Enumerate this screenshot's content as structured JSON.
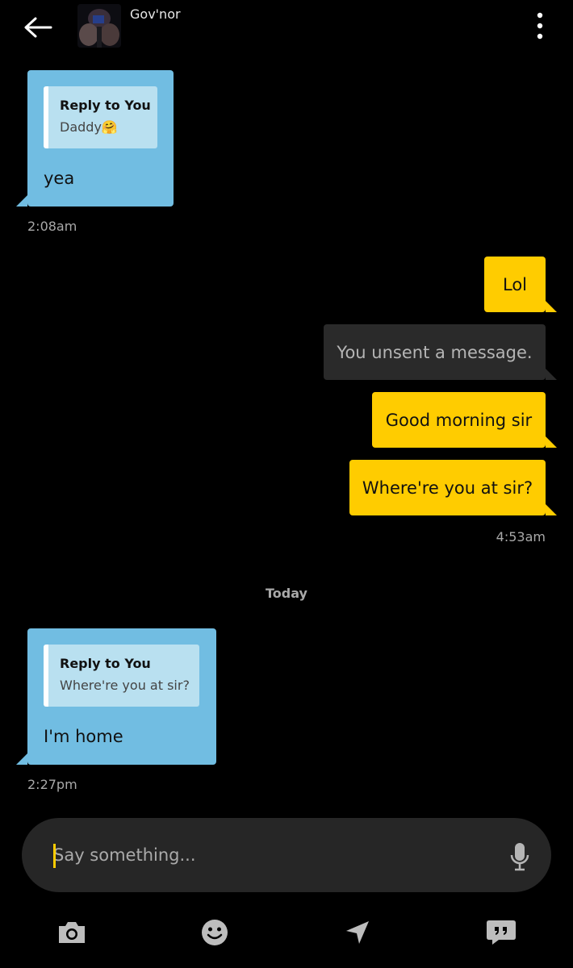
{
  "header": {
    "contact_name": "Gov'nor",
    "back_icon": "arrow-left-icon",
    "more_icon": "more-vertical-icon"
  },
  "messages": [
    {
      "direction": "incoming",
      "reply_title": "Reply to You",
      "reply_text": "Daddy🤗",
      "text": "yea",
      "time": "2:08am"
    },
    {
      "direction": "outgoing",
      "text": "Lol"
    },
    {
      "direction": "outgoing",
      "style": "unsent",
      "text": "You unsent a message."
    },
    {
      "direction": "outgoing",
      "text": "Good morning sir"
    },
    {
      "direction": "outgoing",
      "text": "Where're you at sir?",
      "time": "4:53am"
    },
    {
      "direction": "incoming",
      "reply_title": "Reply to You",
      "reply_text": "Where're you at sir?",
      "text": "I'm home",
      "time": "2:27pm"
    }
  ],
  "date_separator": "Today",
  "composer": {
    "placeholder": "Say something...",
    "mic_icon": "microphone-icon"
  },
  "toolbar": [
    {
      "icon": "camera-icon"
    },
    {
      "icon": "smiley-icon"
    },
    {
      "icon": "location-arrow-icon"
    },
    {
      "icon": "saved-phrases-icon"
    }
  ],
  "colors": {
    "background": "#000000",
    "incoming_bubble": "#71bde2",
    "reply_box": "#b9e0f0",
    "outgoing_bubble": "#ffcc00",
    "unsent_bubble": "#2a2a2a",
    "composer": "#262626",
    "accent": "#ffcc00"
  }
}
